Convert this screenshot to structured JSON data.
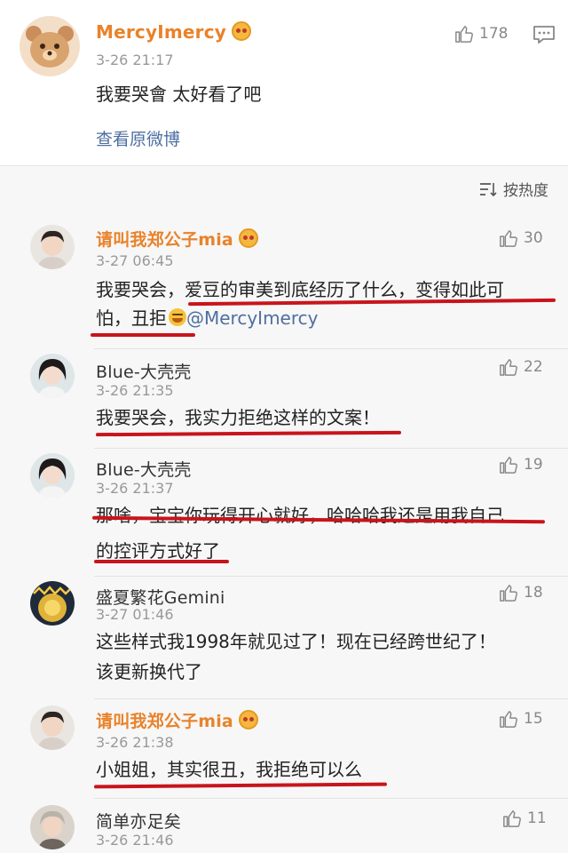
{
  "post": {
    "author": "MercyImercy",
    "time": "3-26 21:17",
    "likes": "178",
    "content": "我要哭會 太好看了吧",
    "view_original": "查看原微博"
  },
  "sort_label": "按热度",
  "comments": [
    {
      "author": "请叫我郑公子mia",
      "time": "3-27 06:45",
      "likes": "30",
      "line1": "我要哭会，爱豆的审美到底经历了什么，变得如此可",
      "line2": "怕，丑拒",
      "mention": "@MercyImercy"
    },
    {
      "author": "Blue-大壳壳",
      "time": "3-26 21:35",
      "likes": "22",
      "line1": "我要哭会，我实力拒绝这样的文案！"
    },
    {
      "author": "Blue-大壳壳",
      "time": "3-26 21:37",
      "likes": "19",
      "line1": "那啥，宝宝你玩得开心就好，哈哈哈我还是用我自己",
      "line2": "的控评方式好了"
    },
    {
      "author": "盛夏繁花Gemini",
      "time": "3-27 01:46",
      "likes": "18",
      "line1": "这些样式我1998年就见过了！现在已经跨世纪了！",
      "line2": "该更新换代了"
    },
    {
      "author": "请叫我郑公子mia",
      "time": "3-26 21:38",
      "likes": "15",
      "line1": "小姐姐，其实很丑，我拒绝可以么"
    },
    {
      "author": "简单亦足矣",
      "time": "3-26 21:46",
      "likes": "11"
    }
  ],
  "colors": {
    "highlight_name": "#e9822a",
    "link": "#4e6fa0",
    "underline": "#c8141c"
  }
}
